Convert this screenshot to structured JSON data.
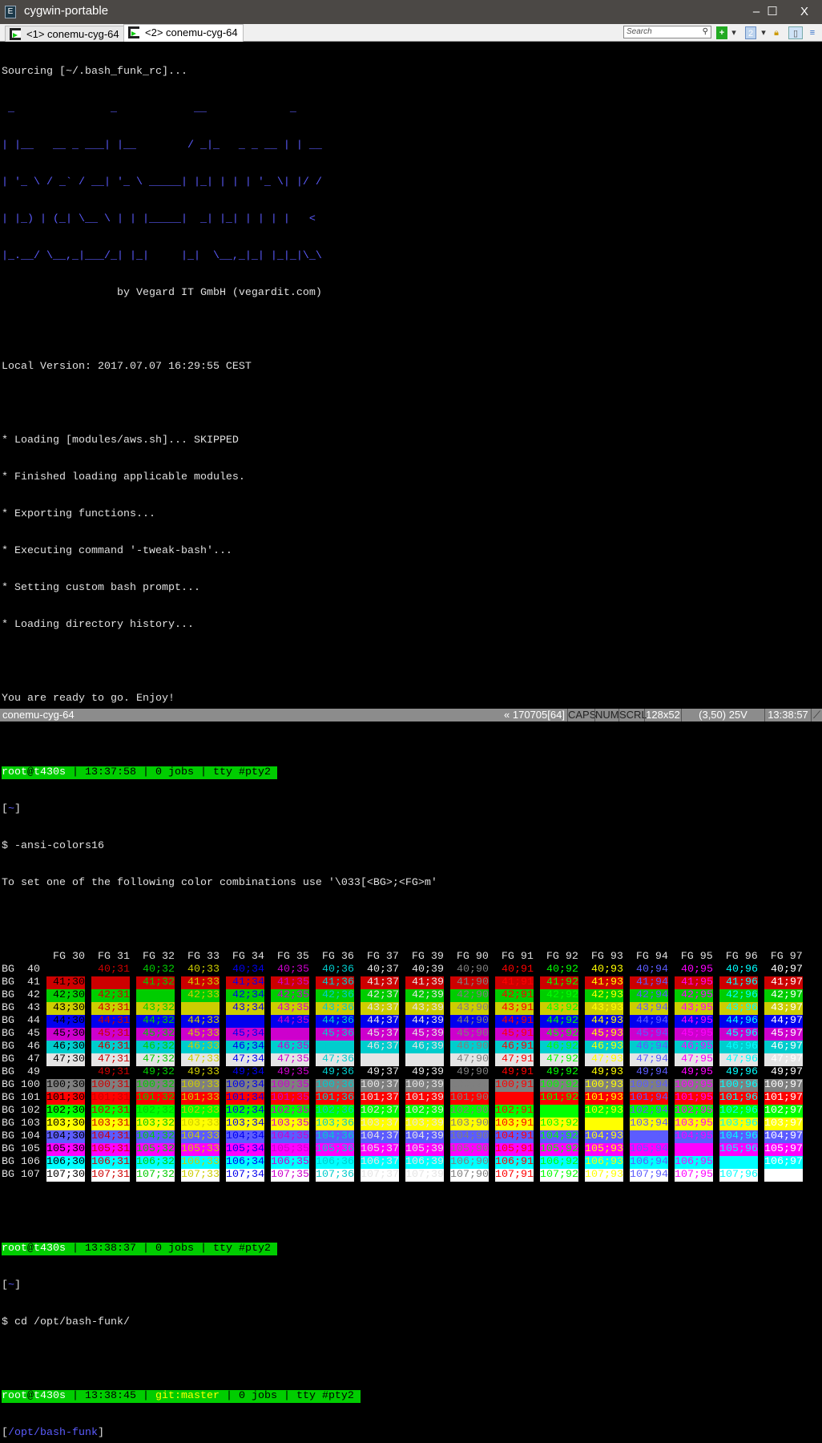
{
  "window": {
    "title": "cygwin-portable",
    "minimize": "–",
    "maximize": "☐",
    "close": "X"
  },
  "tabs": [
    {
      "label": "<1> conemu-cyg-64"
    },
    {
      "label": "<2> conemu-cyg-64"
    }
  ],
  "toolbar": {
    "search_placeholder": "Search",
    "new_console": "+",
    "split": "2"
  },
  "terminal": {
    "lines": [
      "Sourcing [~/.bash_funk_rc]...",
      " _               _            __             _",
      "| |__   __ _ ___| |__        / _|_   _ _ __ | | __",
      "| '_ \\ / _` / __| '_ \\ _____| |_| | | | '_ \\| |/ /",
      "| |_) | (_| \\__ \\ | | |_____|  _| |_| | | | |   <",
      "|_.__/ \\__,_|___/_| |_|     |_|  \\__,_|_| |_|_|\\_\\",
      "                  by Vegard IT GmbH (vegardit.com)",
      "Local Version: 2017.07.07 16:29:55 CEST",
      "* Loading [modules/aws.sh]... SKIPPED",
      "* Finished loading applicable modules.",
      "* Exporting functions...",
      "* Executing command '-tweak-bash'...",
      "* Setting custom bash prompt...",
      "* Loading directory history...",
      "You are ready to go. Enjoy!"
    ],
    "prompts": [
      {
        "user": "root",
        "at": "@",
        "host": "t430s",
        "time": " | 13:37:58",
        "git": "",
        "jobs": " | 0 jobs",
        "tty": " | tty #pty2 ",
        "dir": "~",
        "command": "$ -ansi-colors16"
      },
      {
        "user": "root",
        "at": "@",
        "host": "t430s",
        "time": " | 13:38:37",
        "git": "",
        "jobs": " | 0 jobs",
        "tty": " | tty #pty2 ",
        "dir": "~",
        "command": "$ cd /opt/bash-funk/"
      },
      {
        "user": "root",
        "at": "@",
        "host": "t430s",
        "time": " | 13:38:45 | ",
        "git": "git:master",
        "jobs": " | 0 jobs",
        "tty": " | tty #pty2 ",
        "dir": "/opt/bash-funk",
        "command": "$"
      }
    ],
    "colors_intro": "To set one of the following color combinations use '\\033[<BG>;<FG>m'",
    "color_table": {
      "fg_codes": [
        30,
        31,
        32,
        33,
        34,
        35,
        36,
        37,
        39,
        90,
        91,
        92,
        93,
        94,
        95,
        96,
        97
      ],
      "bg_codes": [
        40,
        41,
        42,
        43,
        44,
        45,
        46,
        47,
        49,
        100,
        101,
        102,
        103,
        104,
        105,
        106,
        107
      ],
      "fg_prefix": "FG",
      "bg_prefix": "BG"
    },
    "palette": {
      "30": "#000000",
      "31": "#cd0000",
      "32": "#00cd00",
      "33": "#cdcd00",
      "34": "#0000ee",
      "35": "#cd00cd",
      "36": "#00cdcd",
      "37": "#e5e5e5",
      "39": "#e5e5e5",
      "90": "#7f7f7f",
      "91": "#ff0000",
      "92": "#00ff00",
      "93": "#ffff00",
      "94": "#5c5cff",
      "95": "#ff00ff",
      "96": "#00ffff",
      "97": "#ffffff",
      "40": "#000000",
      "41": "#cd0000",
      "42": "#00cd00",
      "43": "#cdcd00",
      "44": "#0000ee",
      "45": "#cd00cd",
      "46": "#00cdcd",
      "47": "#e5e5e5",
      "49": "#000000",
      "100": "#7f7f7f",
      "101": "#ff0000",
      "102": "#00ff00",
      "103": "#ffff00",
      "104": "#5c5cff",
      "105": "#ff00ff",
      "106": "#00ffff",
      "107": "#ffffff"
    }
  },
  "statusbar": {
    "console": "conemu-cyg-64",
    "version": "« 170705[64]",
    "caps": "CAPS",
    "num": "NUM",
    "scrl": "SCRL",
    "size": "128x52",
    "cursor": "(3,50) 25V",
    "time": "13:38:57"
  }
}
